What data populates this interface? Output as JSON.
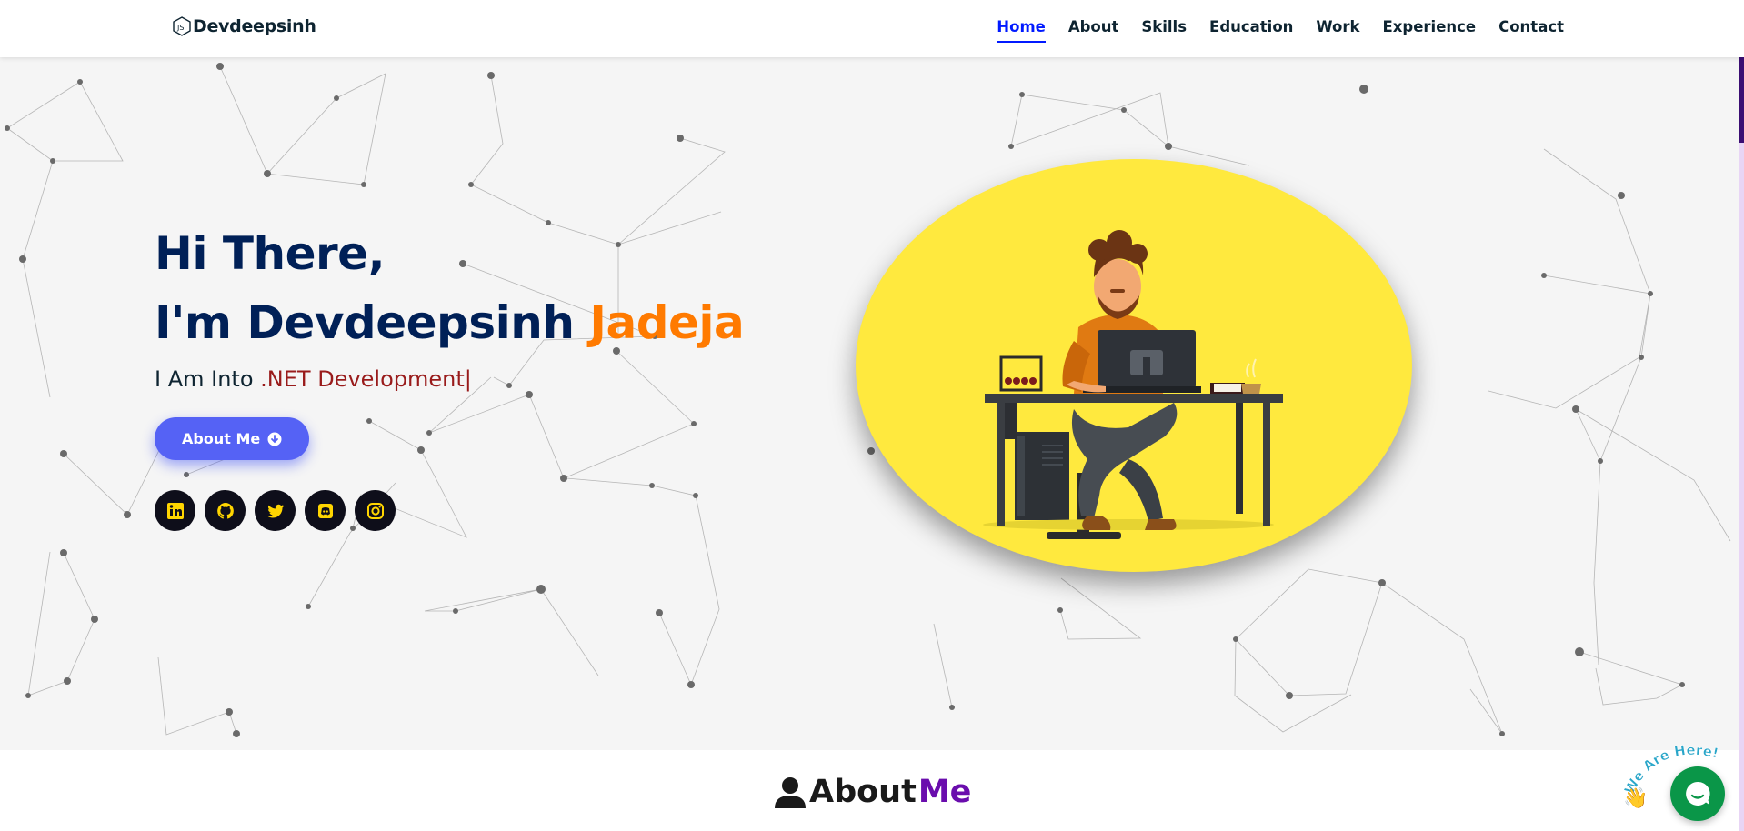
{
  "brand": {
    "name": "Devdeepsinh",
    "icon": "code-hex-icon"
  },
  "nav": {
    "items": [
      {
        "label": "Home",
        "active": true
      },
      {
        "label": "About"
      },
      {
        "label": "Skills"
      },
      {
        "label": "Education"
      },
      {
        "label": "Work"
      },
      {
        "label": "Experience"
      },
      {
        "label": "Contact"
      }
    ]
  },
  "hero": {
    "line1": "Hi There,",
    "line2_prefix": "I'm Devdeepsinh",
    "line2_accent": "Jadeja",
    "typing_prefix": "I Am Into",
    "typing_role": ".NET Development",
    "typing_cursor": "|",
    "button_label": "About Me",
    "socials": [
      "linkedin-icon",
      "github-icon",
      "twitter-icon",
      "discord-icon",
      "instagram-icon"
    ]
  },
  "about": {
    "title": "About",
    "title_accent": "Me"
  },
  "chat_widget": {
    "badge_text": "We Are Here!"
  },
  "colors": {
    "nav_active": "#011aff",
    "heading": "#002057",
    "name_accent": "#ff7a00",
    "role": "#991b1b",
    "button": "#5562f5",
    "illustration_bg": "#ffe93e",
    "about_accent": "#6a0dad",
    "chat": "#0a9648"
  }
}
